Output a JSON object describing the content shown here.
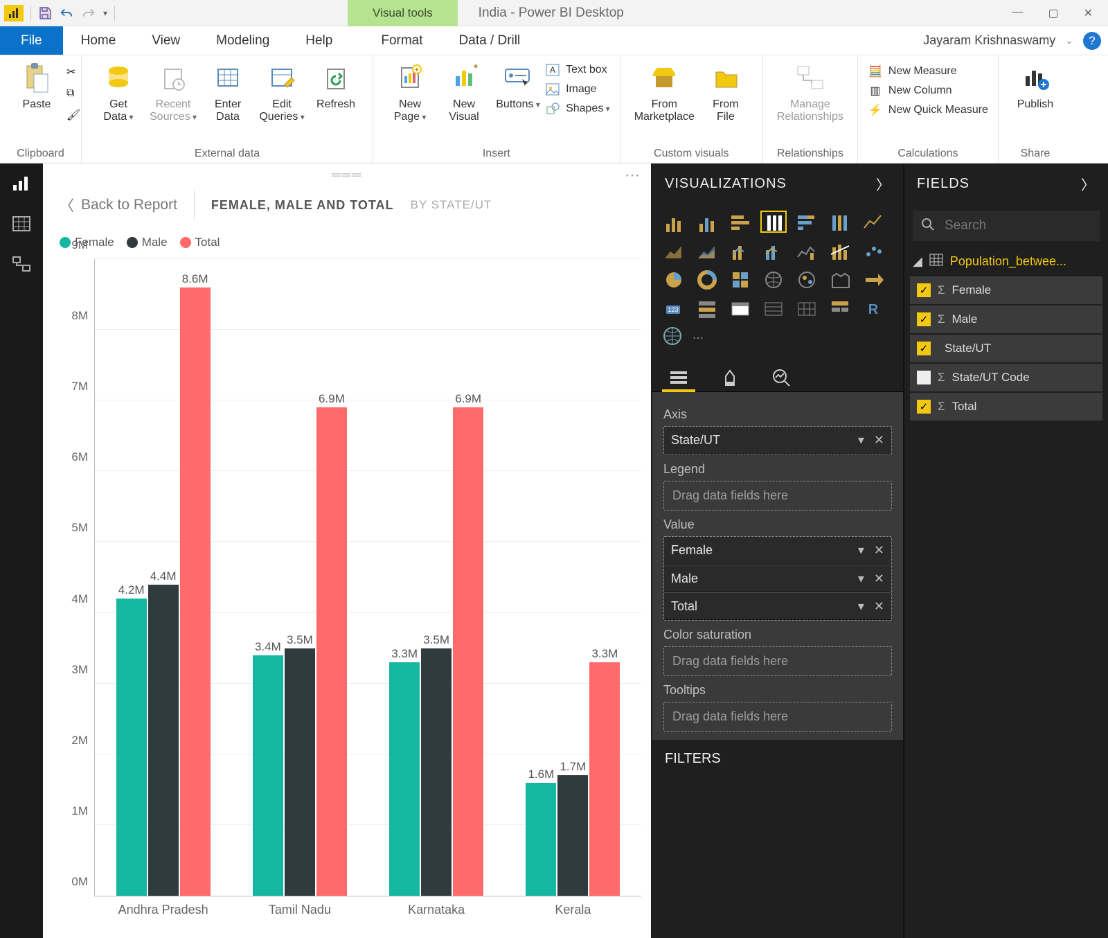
{
  "titlebar": {
    "visual_tools": "Visual tools",
    "doc": "India - Power BI Desktop"
  },
  "menu": {
    "file": "File",
    "home": "Home",
    "view": "View",
    "modeling": "Modeling",
    "help": "Help",
    "format": "Format",
    "datadrill": "Data / Drill",
    "user": "Jayaram Krishnaswamy"
  },
  "ribbon": {
    "paste": "Paste",
    "get_data": "Get\nData",
    "recent_sources": "Recent\nSources",
    "enter_data": "Enter\nData",
    "edit_queries": "Edit\nQueries",
    "refresh": "Refresh",
    "new_page": "New\nPage",
    "new_visual": "New\nVisual",
    "buttons": "Buttons",
    "textbox": "Text box",
    "image": "Image",
    "shapes": "Shapes",
    "from_marketplace": "From\nMarketplace",
    "from_file": "From\nFile",
    "manage_relationships": "Manage\nRelationships",
    "new_measure": "New Measure",
    "new_column": "New Column",
    "new_quick_measure": "New Quick Measure",
    "publish": "Publish",
    "g_clipboard": "Clipboard",
    "g_external": "External data",
    "g_insert": "Insert",
    "g_custom": "Custom visuals",
    "g_rel": "Relationships",
    "g_calc": "Calculations",
    "g_share": "Share"
  },
  "crumb": {
    "back": "Back to Report",
    "title": "FEMALE, MALE AND TOTAL",
    "sub": "BY STATE/UT"
  },
  "legend": {
    "female": "Female",
    "male": "Male",
    "total": "Total"
  },
  "viz": {
    "header": "VISUALIZATIONS",
    "axis": "Axis",
    "legend": "Legend",
    "value": "Value",
    "color_sat": "Color saturation",
    "tooltips": "Tooltips",
    "drag_ph": "Drag data fields here",
    "axis_chip": "State/UT",
    "value_chips": [
      "Female",
      "Male",
      "Total"
    ],
    "filters": "FILTERS"
  },
  "fields": {
    "header": "FIELDS",
    "search_ph": "Search",
    "table": "Population_betwee...",
    "items": [
      {
        "label": "Female",
        "checked": true,
        "sigma": true
      },
      {
        "label": "Male",
        "checked": true,
        "sigma": true
      },
      {
        "label": "State/UT",
        "checked": true,
        "sigma": false
      },
      {
        "label": "State/UT Code",
        "checked": false,
        "sigma": true
      },
      {
        "label": "Total",
        "checked": true,
        "sigma": true
      }
    ]
  },
  "chart_data": {
    "type": "bar",
    "title": "FEMALE, MALE AND TOTAL",
    "subtitle": "BY STATE/UT",
    "ylabel": "",
    "ylim": [
      0,
      9
    ],
    "yticks": [
      "0M",
      "1M",
      "2M",
      "3M",
      "4M",
      "5M",
      "6M",
      "7M",
      "8M",
      "9M"
    ],
    "categories": [
      "Andhra Pradesh",
      "Tamil Nadu",
      "Karnataka",
      "Kerala"
    ],
    "series": [
      {
        "name": "Female",
        "color": "#14b8a0",
        "values": [
          4.2,
          3.4,
          3.3,
          1.6
        ],
        "labels": [
          "4.2M",
          "3.4M",
          "3.3M",
          "1.6M"
        ]
      },
      {
        "name": "Male",
        "color": "#2f3b3f",
        "values": [
          4.4,
          3.5,
          3.5,
          1.7
        ],
        "labels": [
          "4.4M",
          "3.5M",
          "3.5M",
          "1.7M"
        ]
      },
      {
        "name": "Total",
        "color": "#ff6b6b",
        "values": [
          8.6,
          6.9,
          6.9,
          3.3
        ],
        "labels": [
          "8.6M",
          "6.9M",
          "6.9M",
          "3.3M"
        ]
      }
    ]
  }
}
